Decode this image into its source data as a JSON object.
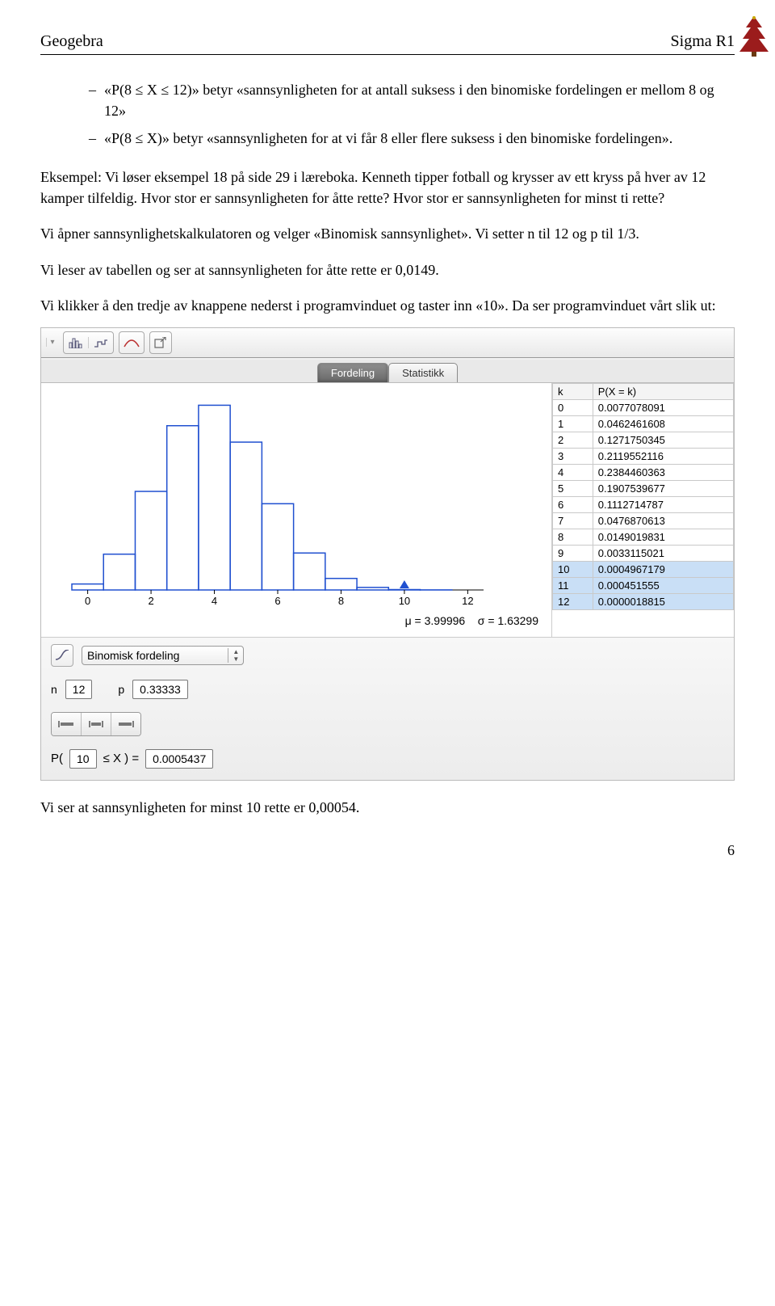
{
  "header": {
    "left": "Geogebra",
    "right": "Sigma R1"
  },
  "bullets": [
    "«P(8 ≤ X ≤ 12)» betyr «sannsynligheten for at antall suksess i den binomiske fordelingen er mellom 8 og 12»",
    "«P(8 ≤ X)» betyr «sannsynligheten for at vi får 8 eller flere suksess i den binomiske fordelingen»."
  ],
  "paragraphs": {
    "p1": "Eksempel: Vi løser eksempel 18 på side 29 i læreboka. Kenneth tipper fotball og krysser av ett kryss på hver av 12 kamper tilfeldig. Hvor stor er sannsynligheten for åtte rette? Hvor stor er sannsynligheten for minst ti rette?",
    "p2": "Vi åpner sannsynlighetskalkulatoren og velger «Binomisk sannsynlighet». Vi setter n til 12 og p til 1/3.",
    "p3": "Vi leser av tabellen og ser at sannsynligheten for åtte rette er 0,0149.",
    "p4": "Vi klikker å den tredje av knappene nederst i programvinduet og taster inn «10». Da ser programvinduet vårt slik ut:",
    "p5": "Vi ser at sannsynligheten for minst 10 rette er 0,00054."
  },
  "app": {
    "tabs": {
      "active": "Fordeling",
      "inactive": "Statistikk"
    },
    "table": {
      "headers": [
        "k",
        "P(X = k)"
      ],
      "rows": [
        [
          "0",
          "0.0077078091"
        ],
        [
          "1",
          "0.0462461608"
        ],
        [
          "2",
          "0.1271750345"
        ],
        [
          "3",
          "0.2119552116"
        ],
        [
          "4",
          "0.2384460363"
        ],
        [
          "5",
          "0.1907539677"
        ],
        [
          "6",
          "0.1112714787"
        ],
        [
          "7",
          "0.0476870613"
        ],
        [
          "8",
          "0.0149019831"
        ],
        [
          "9",
          "0.0033115021"
        ],
        [
          "10",
          "0.0004967179"
        ],
        [
          "11",
          "0.000451555"
        ],
        [
          "12",
          "0.0000018815"
        ]
      ],
      "selected_from": 10
    },
    "stats": {
      "mu_label": "μ = 3.99996",
      "sigma_label": "σ = 1.63299"
    },
    "distribution": {
      "name": "Binomisk fordeling"
    },
    "params": {
      "n_label": "n",
      "n_value": "12",
      "p_label": "p",
      "p_value": "0.33333"
    },
    "calc": {
      "prefix": "P(",
      "x_value": "10",
      "rel": "≤ X ) =",
      "result": "0.0005437"
    }
  },
  "chart_data": {
    "type": "bar",
    "categories": [
      0,
      1,
      2,
      3,
      4,
      5,
      6,
      7,
      8,
      9,
      10,
      11,
      12
    ],
    "values": [
      0.0077,
      0.0462,
      0.1272,
      0.212,
      0.2384,
      0.1908,
      0.1113,
      0.0477,
      0.0149,
      0.0033,
      0.0005,
      0.0001,
      0.0
    ],
    "title": "",
    "xlabel": "",
    "ylabel": "",
    "xlim": [
      0,
      12
    ],
    "ylim": [
      0,
      0.25
    ],
    "x_ticks": [
      0,
      2,
      4,
      6,
      8,
      10,
      12
    ],
    "marker_x": 10
  },
  "page_number": "6"
}
